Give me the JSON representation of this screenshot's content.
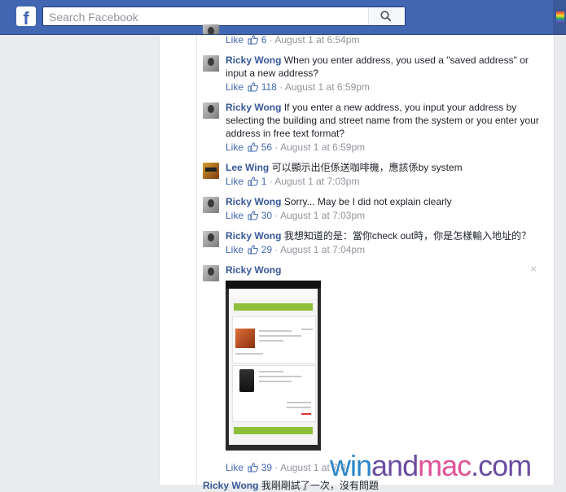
{
  "header": {
    "logo": "f",
    "search": {
      "placeholder": "Search Facebook"
    }
  },
  "like_label": "Like",
  "separator": "·",
  "close_glyph": "×",
  "comments": [
    {
      "name": "",
      "text": "",
      "likes": "6",
      "time": "August 1 at 6:54pm",
      "avatar": "ricky"
    },
    {
      "name": "Ricky Wong",
      "text": "When you enter address, you used a \"saved address\" or input a new address?",
      "likes": "118",
      "time": "August 1 at 6:59pm",
      "avatar": "ricky"
    },
    {
      "name": "Ricky Wong",
      "text": "If you enter a new address, you input your address by selecting the building and street name from the system or you enter your address in free text format?",
      "likes": "56",
      "time": "August 1 at 6:59pm",
      "avatar": "ricky"
    },
    {
      "name": "Lee Wing",
      "text": "可以顯示出佢係送咖啡機，應該係by system",
      "likes": "1",
      "time": "August 1 at 7:03pm",
      "avatar": "lee"
    },
    {
      "name": "Ricky Wong",
      "text": "Sorry... May be I did not explain clearly",
      "likes": "30",
      "time": "August 1 at 7:03pm",
      "avatar": "ricky"
    },
    {
      "name": "Ricky Wong",
      "text": "我想知道的是：當你check out時，你是怎樣輸入地址的？",
      "likes": "29",
      "time": "August 1 at 7:04pm",
      "avatar": "ricky"
    },
    {
      "name": "Ricky Wong",
      "text": "",
      "likes": "39",
      "time": "August 1 at 7:0",
      "avatar": "ricky",
      "has_image": true
    }
  ],
  "partial_next": {
    "name": "Ricky Wong",
    "text": "我剛剛試了一次，沒有問題"
  },
  "watermark": {
    "part1": "win",
    "part2": "and",
    "part3": "mac",
    "part4": ".com"
  },
  "colors": {
    "brand_blue": "#4267b2",
    "link": "#385898",
    "meta_gray": "#90949c",
    "text": "#1d2129"
  }
}
